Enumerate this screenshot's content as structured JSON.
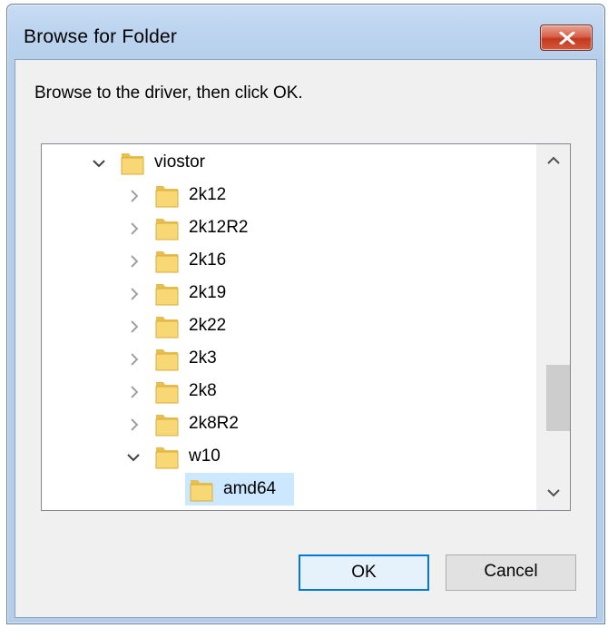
{
  "dialog": {
    "title": "Browse for Folder",
    "instruction": "Browse to the driver, then click OK."
  },
  "tree": {
    "items": [
      {
        "label": "viostor",
        "expanded": true,
        "level": 0,
        "expander": "chevron-down"
      },
      {
        "label": "2k12",
        "expanded": false,
        "level": 1,
        "expander": "chevron-right"
      },
      {
        "label": "2k12R2",
        "expanded": false,
        "level": 1,
        "expander": "chevron-right"
      },
      {
        "label": "2k16",
        "expanded": false,
        "level": 1,
        "expander": "chevron-right"
      },
      {
        "label": "2k19",
        "expanded": false,
        "level": 1,
        "expander": "chevron-right"
      },
      {
        "label": "2k22",
        "expanded": false,
        "level": 1,
        "expander": "chevron-right"
      },
      {
        "label": "2k3",
        "expanded": false,
        "level": 1,
        "expander": "chevron-right"
      },
      {
        "label": "2k8",
        "expanded": false,
        "level": 1,
        "expander": "chevron-right"
      },
      {
        "label": "2k8R2",
        "expanded": false,
        "level": 1,
        "expander": "chevron-right"
      },
      {
        "label": "w10",
        "expanded": true,
        "level": 1,
        "expander": "chevron-down"
      },
      {
        "label": "amd64",
        "expanded": false,
        "level": 2,
        "expander": "none",
        "selected": true
      }
    ]
  },
  "buttons": {
    "ok_label": "OK",
    "cancel_label": "Cancel"
  },
  "colors": {
    "selection": "#cce8ff",
    "ok_border": "#0078d7",
    "folder_fill": "#f8d775",
    "close_button": "#c4391e"
  },
  "icons": {
    "close": "close-icon",
    "folder": "folder-icon",
    "expand": "chevron-right-icon",
    "collapse": "chevron-down-icon",
    "scroll_up": "chevron-up-icon",
    "scroll_down": "chevron-down-icon"
  }
}
